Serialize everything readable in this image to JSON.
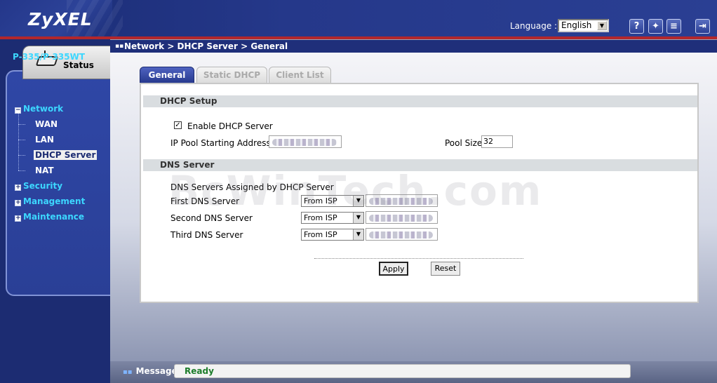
{
  "header": {
    "brand": "ZyXEL",
    "language_label": "Language :",
    "language_value": "English",
    "icons": [
      "help-icon",
      "wizard-icon",
      "notes-icon",
      "logout-icon"
    ],
    "help_glyph": "?"
  },
  "breadcrumb": "Network > DHCP Server > General",
  "sidebar": {
    "status_label": "Status",
    "model": "P-335/P-335WT",
    "items": [
      {
        "label": "Network",
        "expanded": true
      },
      {
        "label": "WAN"
      },
      {
        "label": "LAN"
      },
      {
        "label": "DHCP Server",
        "selected": true
      },
      {
        "label": "NAT"
      },
      {
        "label": "Security",
        "expanded": false
      },
      {
        "label": "Management",
        "expanded": false
      },
      {
        "label": "Maintenance",
        "expanded": false
      }
    ],
    "expand_minus": "−",
    "expand_plus": "+"
  },
  "tabs": [
    {
      "label": "General",
      "active": true
    },
    {
      "label": "Static DHCP",
      "active": false
    },
    {
      "label": "Client List",
      "active": false
    }
  ],
  "dhcp_setup": {
    "title": "DHCP Setup",
    "enable_label": "Enable DHCP Server",
    "enable_checked": true,
    "check_glyph": "✓",
    "ip_pool_label": "IP Pool Starting Address",
    "pool_size_label": "Pool Size",
    "pool_size_value": "32"
  },
  "dns_server": {
    "title": "DNS Server",
    "assigned_label": "DNS Servers Assigned by DHCP Server",
    "rows": [
      {
        "label": "First DNS Server",
        "mode": "From ISP"
      },
      {
        "label": "Second DNS Server",
        "mode": "From ISP"
      },
      {
        "label": "Third DNS Server",
        "mode": "From ISP"
      }
    ]
  },
  "buttons": {
    "apply": "Apply",
    "reset": "Reset"
  },
  "watermark": "BcWinTech.com",
  "footer": {
    "message_label": "Message",
    "message_value": "Ready"
  },
  "colors": {
    "nav_bg": "#1c2c72",
    "accent_red": "#b2272c",
    "cyan_text": "#3cd7ff",
    "ready_green": "#1d7d2b"
  }
}
